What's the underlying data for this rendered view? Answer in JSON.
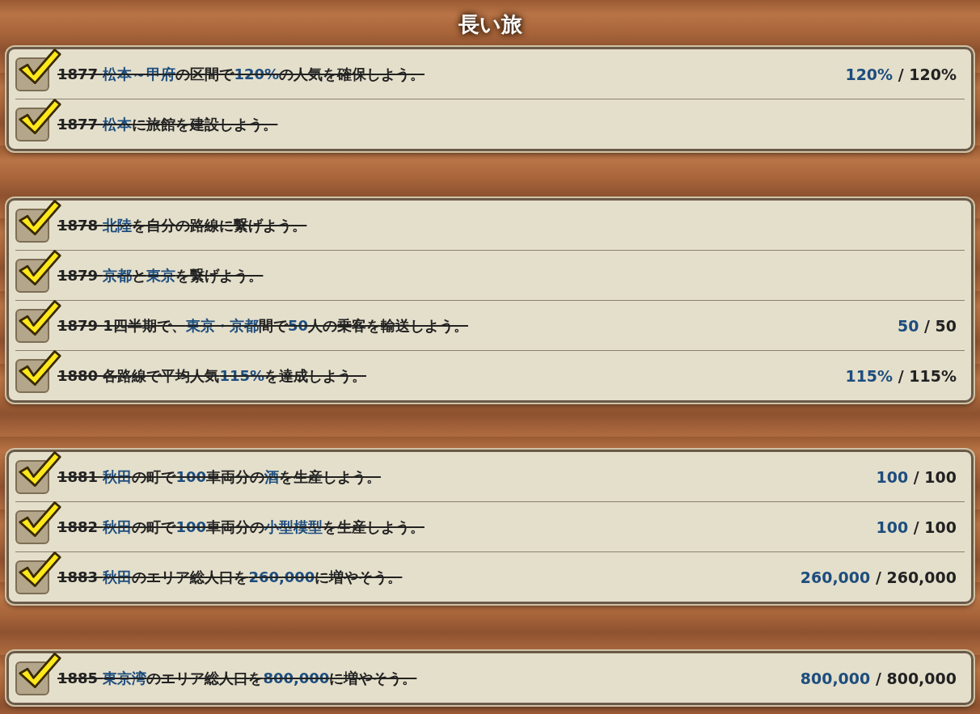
{
  "title": "長い旅",
  "groups": [
    {
      "missions": [
        {
          "text": "1877 **松本～甲府**の区間で**120%**の人気を確保しよう。",
          "completed": true,
          "progress": "**120%** / 120%"
        },
        {
          "text": "1877 **松本**に旅館を建設しよう。",
          "completed": true
        }
      ]
    },
    {
      "missions": [
        {
          "text": "1878 **北陸**を自分の路線に繋げよう。",
          "completed": true
        },
        {
          "text": "1879 **京都**と**東京**を繋げよう。",
          "completed": true
        },
        {
          "text": "1879 1四半期で、**東京・京都**間で**50**人の乗客を輸送しよう。",
          "completed": true,
          "progress": "**50** / 50"
        },
        {
          "text": "1880 各路線で平均人気**115%**を達成しよう。",
          "completed": true,
          "progress": "**115%** / 115%"
        }
      ]
    },
    {
      "missions": [
        {
          "text": "1881 **秋田**の町で**100**車両分の**酒**を生産しよう。",
          "completed": true,
          "progress": "**100** / 100"
        },
        {
          "text": "1882 **秋田**の町で**100**車両分の**小型模型**を生産しよう。",
          "completed": true,
          "progress": "**100** / 100"
        },
        {
          "text": "1883 **秋田**のエリア総人口を**260,000**に増やそう。",
          "completed": true,
          "progress": "**260,000** / 260,000"
        }
      ]
    },
    {
      "missions": [
        {
          "text": "1885 **東京湾**のエリア総人口を**800,000**に増やそう。",
          "completed": true,
          "progress": "**800,000** / 800,000"
        }
      ]
    }
  ]
}
